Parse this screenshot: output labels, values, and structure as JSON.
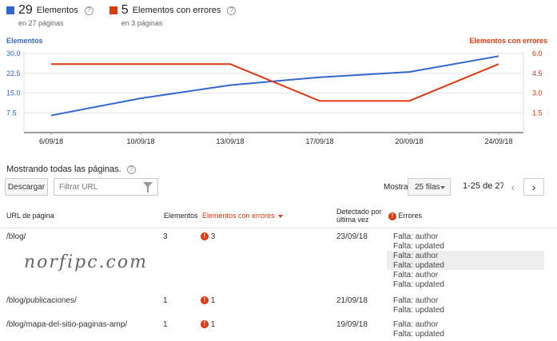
{
  "summary": {
    "elements": {
      "count": "29",
      "label": "Elementos",
      "sub": "en 27 páginas",
      "color": "#3366cc"
    },
    "errors": {
      "count": "5",
      "label": "Elementos con errores",
      "sub": "en 3 páginas",
      "color": "#dc3912"
    },
    "help_glyph": "?"
  },
  "chart_data": {
    "type": "line",
    "categories": [
      "6/09/18",
      "10/09/18",
      "13/09/18",
      "17/09/18",
      "20/09/18",
      "24/09/18"
    ],
    "series": [
      {
        "name": "Elementos",
        "axis": "left",
        "color": "#3366cc",
        "values": [
          6.5,
          13,
          18,
          21,
          23,
          29
        ]
      },
      {
        "name": "Elementos con errores",
        "axis": "right",
        "color": "#dc3912",
        "values": [
          5.2,
          5.2,
          5.2,
          2.4,
          2.4,
          5.2
        ]
      }
    ],
    "y_left": {
      "label": "Elementos",
      "ticks": [
        "30.0",
        "22.5",
        "15.0",
        "7.5"
      ],
      "ylim": [
        0,
        30
      ]
    },
    "y_right": {
      "label": "Elementos con errores",
      "ticks": [
        "6.0",
        "4.5",
        "3.0",
        "1.5"
      ],
      "ylim": [
        0,
        6
      ]
    },
    "grid": true
  },
  "list": {
    "showing": "Mostrando todas las páginas.",
    "download_label": "Descargar",
    "filter_placeholder": "Filtrar URL",
    "show_label": "Mostrar",
    "rows_value": "25 filas",
    "range": "1-25 de 27",
    "prev_glyph": "‹",
    "next_glyph": "›"
  },
  "table": {
    "headers": {
      "url": "URL de página",
      "elements": "Elementos",
      "errors": "Elementos con errores",
      "detected": "Detectado por última vez",
      "error_col": "Errores"
    },
    "error_glyph": "!",
    "rows": [
      {
        "url": "/blog/",
        "elements": "3",
        "errors": "3",
        "detected": "23/09/18",
        "details": [
          "Falta: author",
          "Falta: updated",
          "Falta: author",
          "Falta: updated",
          "Falta: author",
          "Falta: updated"
        ]
      },
      {
        "url": "/blog/publicaciones/",
        "elements": "1",
        "errors": "1",
        "detected": "21/09/18",
        "details": [
          "Falta: author",
          "Falta: updated"
        ]
      },
      {
        "url": "/blog/mapa-del-sitio-paginas-amp/",
        "elements": "1",
        "errors": "1",
        "detected": "19/09/18",
        "details": [
          "Falta: author",
          "Falta: updated"
        ]
      }
    ]
  },
  "watermark": "norfipc.com"
}
